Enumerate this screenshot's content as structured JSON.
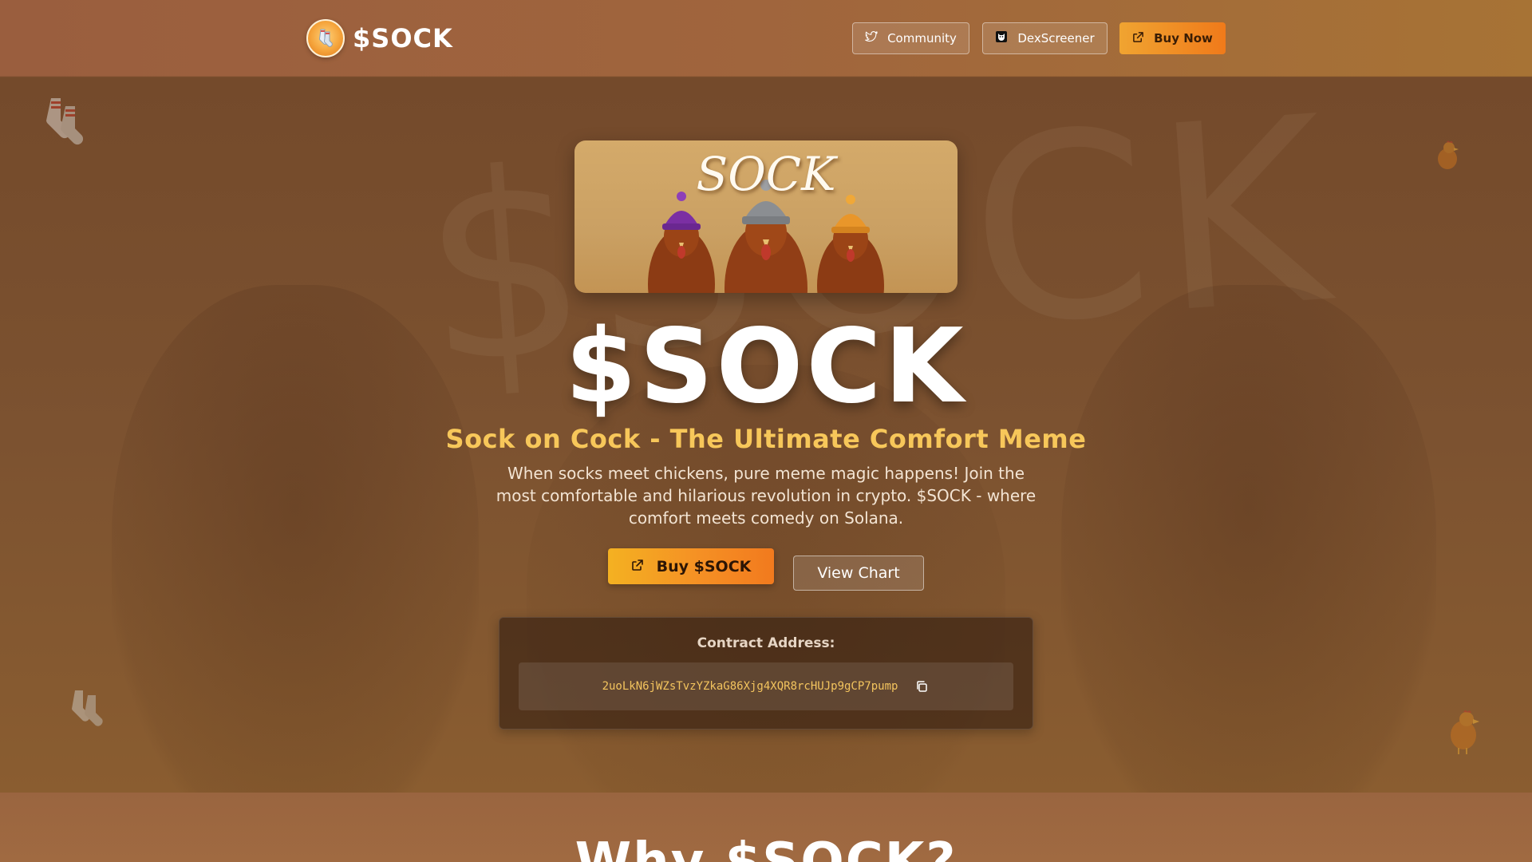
{
  "brand": {
    "name": "$SOCK",
    "logo_icon": "socks-logo-icon"
  },
  "nav": {
    "community_label": "Community",
    "community_icon": "twitter-bird-icon",
    "dex_label": "DexScreener",
    "dex_icon": "dexscreener-icon",
    "buy_label": "Buy Now",
    "buy_icon": "external-link-icon"
  },
  "hero": {
    "image_text": "SOCK",
    "title": "$SOCK",
    "subtitle": "Sock on Cock - The Ultimate Comfort Meme",
    "description": "When socks meet chickens, pure meme magic happens! Join the most comfortable and hilarious revolution in crypto. $SOCK - where comfort meets comedy on Solana.",
    "primary_cta": "Buy $SOCK",
    "primary_cta_icon": "external-link-icon",
    "secondary_cta": "View Chart"
  },
  "contract": {
    "label": "Contract Address:",
    "address": "2uoLkN6jWZsTvzYZkaG86Xjg4XQR8rcHUJp9gCP7pump",
    "copy_icon": "copy-icon"
  },
  "why": {
    "title": "Why $SOCK?"
  },
  "colors": {
    "accent": "#f7c75a",
    "cta_gradient_start": "#f4b122",
    "cta_gradient_end": "#f27a1e",
    "contract_text": "#f3c45e",
    "hero_bg": "#7a4e2c"
  }
}
